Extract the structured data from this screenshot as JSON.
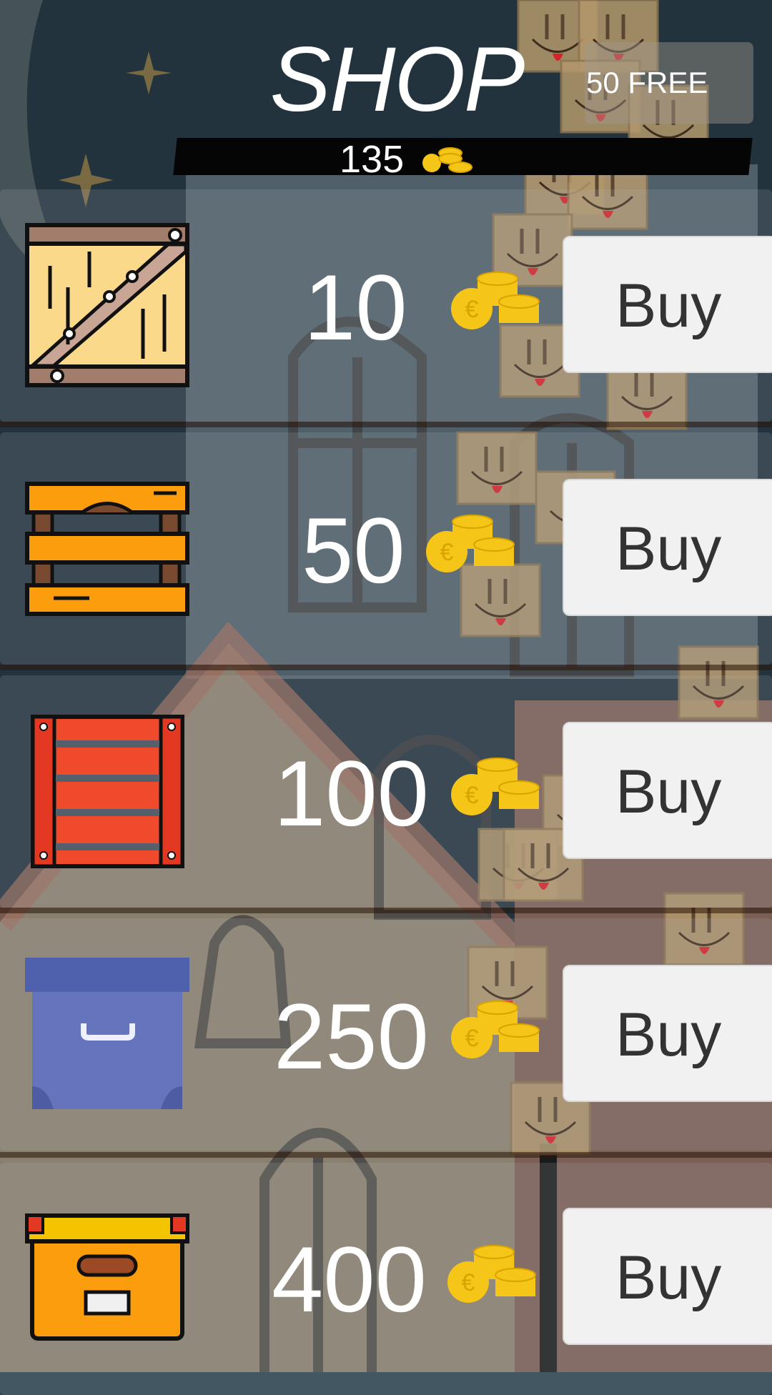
{
  "header": {
    "title": "SHOP",
    "coin_balance": "135",
    "free_offer_label": "50 FREE"
  },
  "items": [
    {
      "price": "10",
      "buy_label": "Buy",
      "icon": "wooden-crate-icon"
    },
    {
      "price": "50",
      "buy_label": "Buy",
      "icon": "orange-crate-icon"
    },
    {
      "price": "100",
      "buy_label": "Buy",
      "icon": "red-crate-icon"
    },
    {
      "price": "250",
      "buy_label": "Buy",
      "icon": "blue-box-icon"
    },
    {
      "price": "400",
      "buy_label": "Buy",
      "icon": "orange-chest-icon"
    }
  ],
  "colors": {
    "accent_coin": "#f5c518",
    "button_bg": "#f1f1f1",
    "background": "#2d4450"
  }
}
